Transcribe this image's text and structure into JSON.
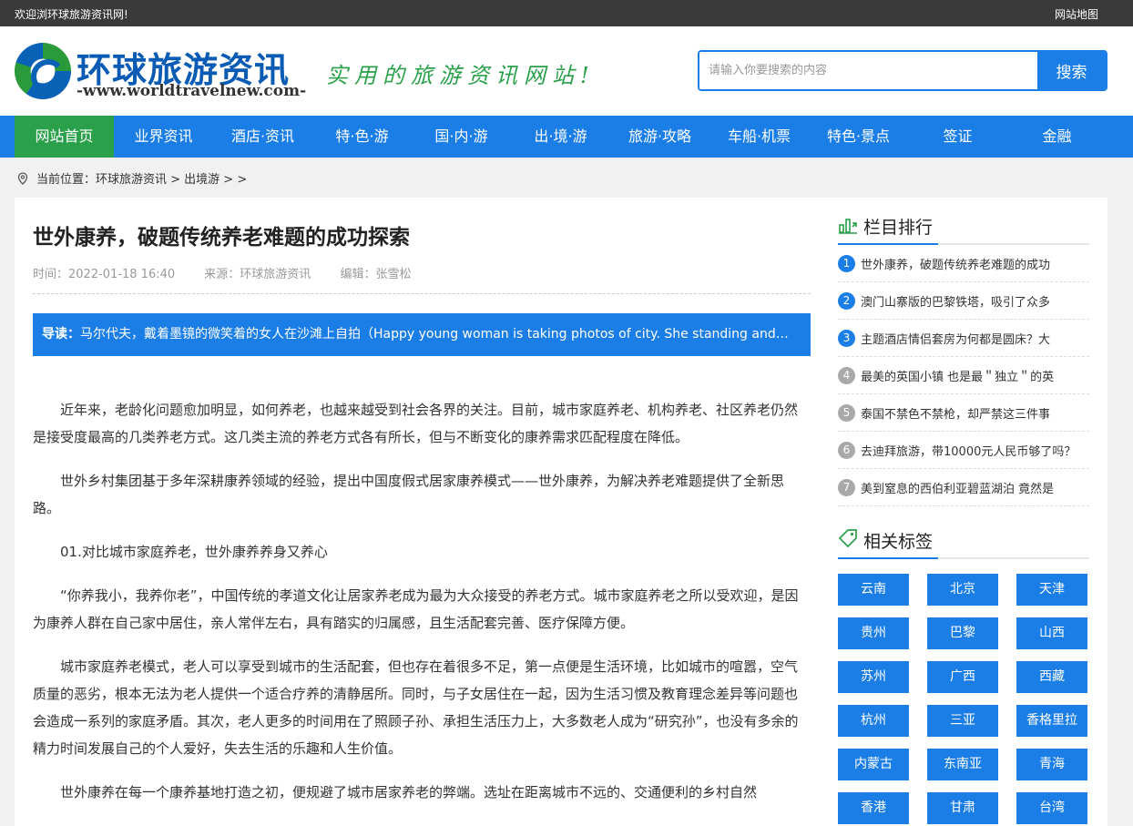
{
  "topbar": {
    "welcome": "欢迎浏环球旅游资讯网!",
    "sitemap": "网站地图"
  },
  "logo": {
    "title": "环球旅游资讯",
    "subtitle": "-www.worldtravelnew.com-",
    "slogan": "实用的旅游资讯网站!"
  },
  "search": {
    "placeholder": "请输入你要搜索的内容",
    "button": "搜索"
  },
  "nav": [
    {
      "label": "网站首页",
      "active": true
    },
    {
      "label": "业界资讯"
    },
    {
      "label": "酒店·资讯"
    },
    {
      "label": "特·色·游"
    },
    {
      "label": "国·内·游"
    },
    {
      "label": "出·境·游"
    },
    {
      "label": "旅游·攻略"
    },
    {
      "label": "车船·机票"
    },
    {
      "label": "特色·景点"
    },
    {
      "label": "签证"
    },
    {
      "label": "金融"
    }
  ],
  "breadcrumb": {
    "text": "当前位置：环球旅游资讯 > 出境游 > >"
  },
  "article": {
    "title": "世外康养，破题传统养老难题的成功探索",
    "time": "时间：2022-01-18 16:40",
    "source": "来源：环球旅游资讯",
    "editor": "编辑：张雪松",
    "lead_label": "导读：",
    "lead_text": "马尔代夫，戴着墨镜的微笑着的女人在沙滩上自拍（Happy young woman is taking photos of city. She standing and laughing...",
    "paragraphs": [
      "近年来，老龄化问题愈加明显，如何养老，也越来越受到社会各界的关注。目前，城市家庭养老、机构养老、社区养老仍然是接受度最高的几类养老方式。这几类主流的养老方式各有所长，但与不断变化的康养需求匹配程度在降低。",
      "世外乡村集团基于多年深耕康养领域的经验，提出中国度假式居家康养模式——世外康养，为解决养老难题提供了全新思路。",
      "01.对比城市家庭养老，世外康养养身又养心",
      "“你养我小，我养你老”，中国传统的孝道文化让居家养老成为最为大众接受的养老方式。城市家庭养老之所以受欢迎，是因为康养人群在自己家中居住，亲人常伴左右，具有踏实的归属感，且生活配套完善、医疗保障方便。",
      "城市家庭养老模式，老人可以享受到城市的生活配套，但也存在着很多不足，第一点便是生活环境，比如城市的喧嚣，空气质量的恶劣，根本无法为老人提供一个适合疗养的清静居所。同时，与子女居住在一起，因为生活习惯及教育理念差异等问题也会造成一系列的家庭矛盾。其次，老人更多的时间用在了照顾子孙、承担生活压力上，大多数老人成为“研究孙”，也没有多余的精力时间发展自己的个人爱好，失去生活的乐趣和人生价值。",
      "世外康养在每一个康养基地打造之初，便规避了城市居家养老的弊端。选址在距离城市不远的、交通便利的乡村自然"
    ]
  },
  "sidebar": {
    "ranking_title": "栏目排行",
    "ranking": [
      "世外康养，破题传统养老难题的成功",
      "澳门山寨版的巴黎铁塔，吸引了众多",
      "主题酒店情侣套房为何都是圆床？大",
      "最美的英国小镇 也是最＂独立＂的英",
      "泰国不禁色不禁枪，却严禁这三件事",
      "去迪拜旅游，带10000元人民币够了吗？",
      "美到窒息的西伯利亚碧蓝湖泊 竟然是"
    ],
    "ranking_numbers": [
      "1",
      "2",
      "3",
      "4",
      "5",
      "6",
      "7"
    ],
    "tags_title": "相关标签",
    "tags": [
      "云南",
      "北京",
      "天津",
      "贵州",
      "巴黎",
      "山西",
      "苏州",
      "广西",
      "西藏",
      "杭州",
      "三亚",
      "香格里拉",
      "内蒙古",
      "东南亚",
      "青海",
      "香港",
      "甘肃",
      "台湾"
    ]
  },
  "colors": {
    "brand_blue": "#1b7ee6",
    "brand_green": "#2aa04a",
    "topbar": "#3a3a3a"
  }
}
